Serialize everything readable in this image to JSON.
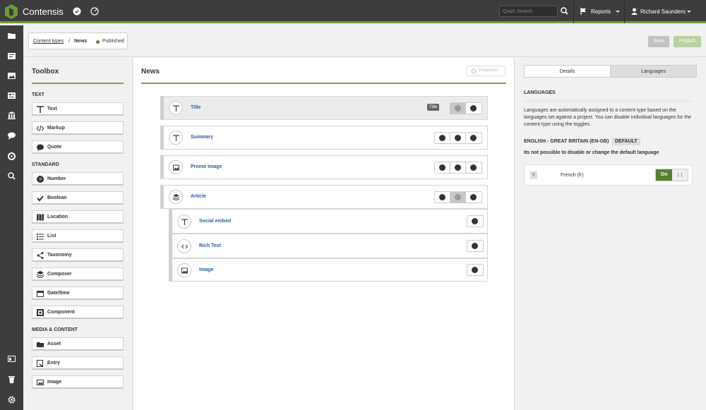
{
  "app": {
    "name": "Contensis"
  },
  "topbar": {
    "search_placeholder": "Quick Search",
    "reports_label": "Reports",
    "user_name": "Richard Saunders"
  },
  "breadcrumb": {
    "parent": "Content types",
    "separator": "/",
    "current": "News",
    "status": "Published"
  },
  "actions": {
    "save_label": "Save",
    "publish_label": "Publish"
  },
  "toolbox": {
    "title": "Toolbox",
    "sections": [
      {
        "title": "TEXT",
        "items": [
          "Text",
          "Markup",
          "Quote"
        ]
      },
      {
        "title": "STANDARD",
        "items": [
          "Number",
          "Boolean",
          "Location",
          "List",
          "Taxonomy",
          "Composer",
          "Date/time",
          "Component"
        ]
      },
      {
        "title": "MEDIA & CONTENT",
        "items": [
          "Asset",
          "Entry",
          "Image"
        ]
      }
    ]
  },
  "editor": {
    "title": "News",
    "properties_label": "Properties",
    "fields": [
      {
        "label": "Title",
        "icon": "text-icon",
        "badge": "Title"
      },
      {
        "label": "Summary",
        "icon": "text-icon"
      },
      {
        "label": "Promo Image",
        "icon": "image-icon"
      },
      {
        "label": "Article",
        "icon": "composer-icon"
      }
    ],
    "sub_fields": [
      {
        "label": "Social embed",
        "icon": "text-icon"
      },
      {
        "label": "Rich Text",
        "icon": "markup-icon"
      },
      {
        "label": "Image",
        "icon": "image-icon"
      }
    ]
  },
  "right_panel": {
    "tabs": [
      "Details",
      "Languages"
    ],
    "languages_heading": "LANGUAGES",
    "description": "Languages are automatically assigned to a content type based on the languages set against a project. You can disable individual languages for the content type using the toggles.",
    "default_language": "ENGLISH - GREAT BRITAIN (EN-GB)",
    "default_badge": "DEFAULT",
    "note": "Its not possible to disable or change the default language",
    "language_row": {
      "code": "fr",
      "name": "French (fr)",
      "toggle": "On"
    }
  },
  "colors": {
    "accent": "#6b9a3a",
    "topbar": "#3d3d3d",
    "link": "#2b5ea3"
  }
}
